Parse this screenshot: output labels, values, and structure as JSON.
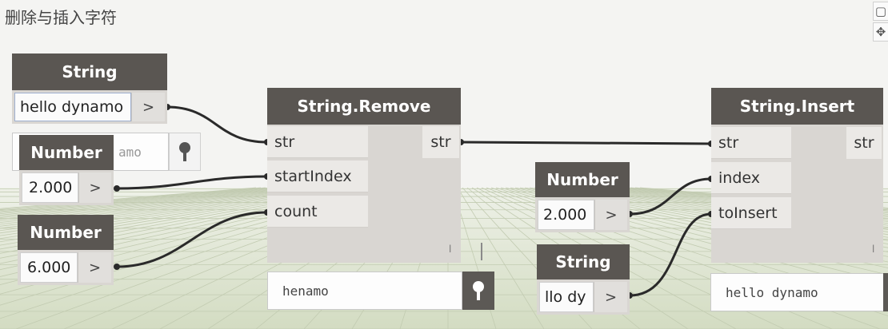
{
  "title": "删除与插入字符",
  "nav_icons": [
    "expand-icon",
    "move-icon"
  ],
  "nodes": {
    "string_input_1": {
      "header": "String",
      "value": "hello dynamo",
      "arrow": ">"
    },
    "number_1": {
      "header": "Number",
      "value": "2.000",
      "arrow": ">",
      "hidden_watch_text": "amo"
    },
    "number_2": {
      "header": "Number",
      "value": "6.000",
      "arrow": ">"
    },
    "string_remove": {
      "header": "String.Remove",
      "inputs": [
        "str",
        "startIndex",
        "count"
      ],
      "output": "str",
      "watch": "henamo"
    },
    "number_3": {
      "header": "Number",
      "value": "2.000",
      "arrow": ">"
    },
    "string_input_2": {
      "header": "String",
      "value": "llo dy",
      "arrow": ">"
    },
    "string_insert": {
      "header": "String.Insert",
      "inputs": [
        "str",
        "index",
        "toInsert"
      ],
      "output": "str",
      "watch": "hello dynamo"
    }
  }
}
